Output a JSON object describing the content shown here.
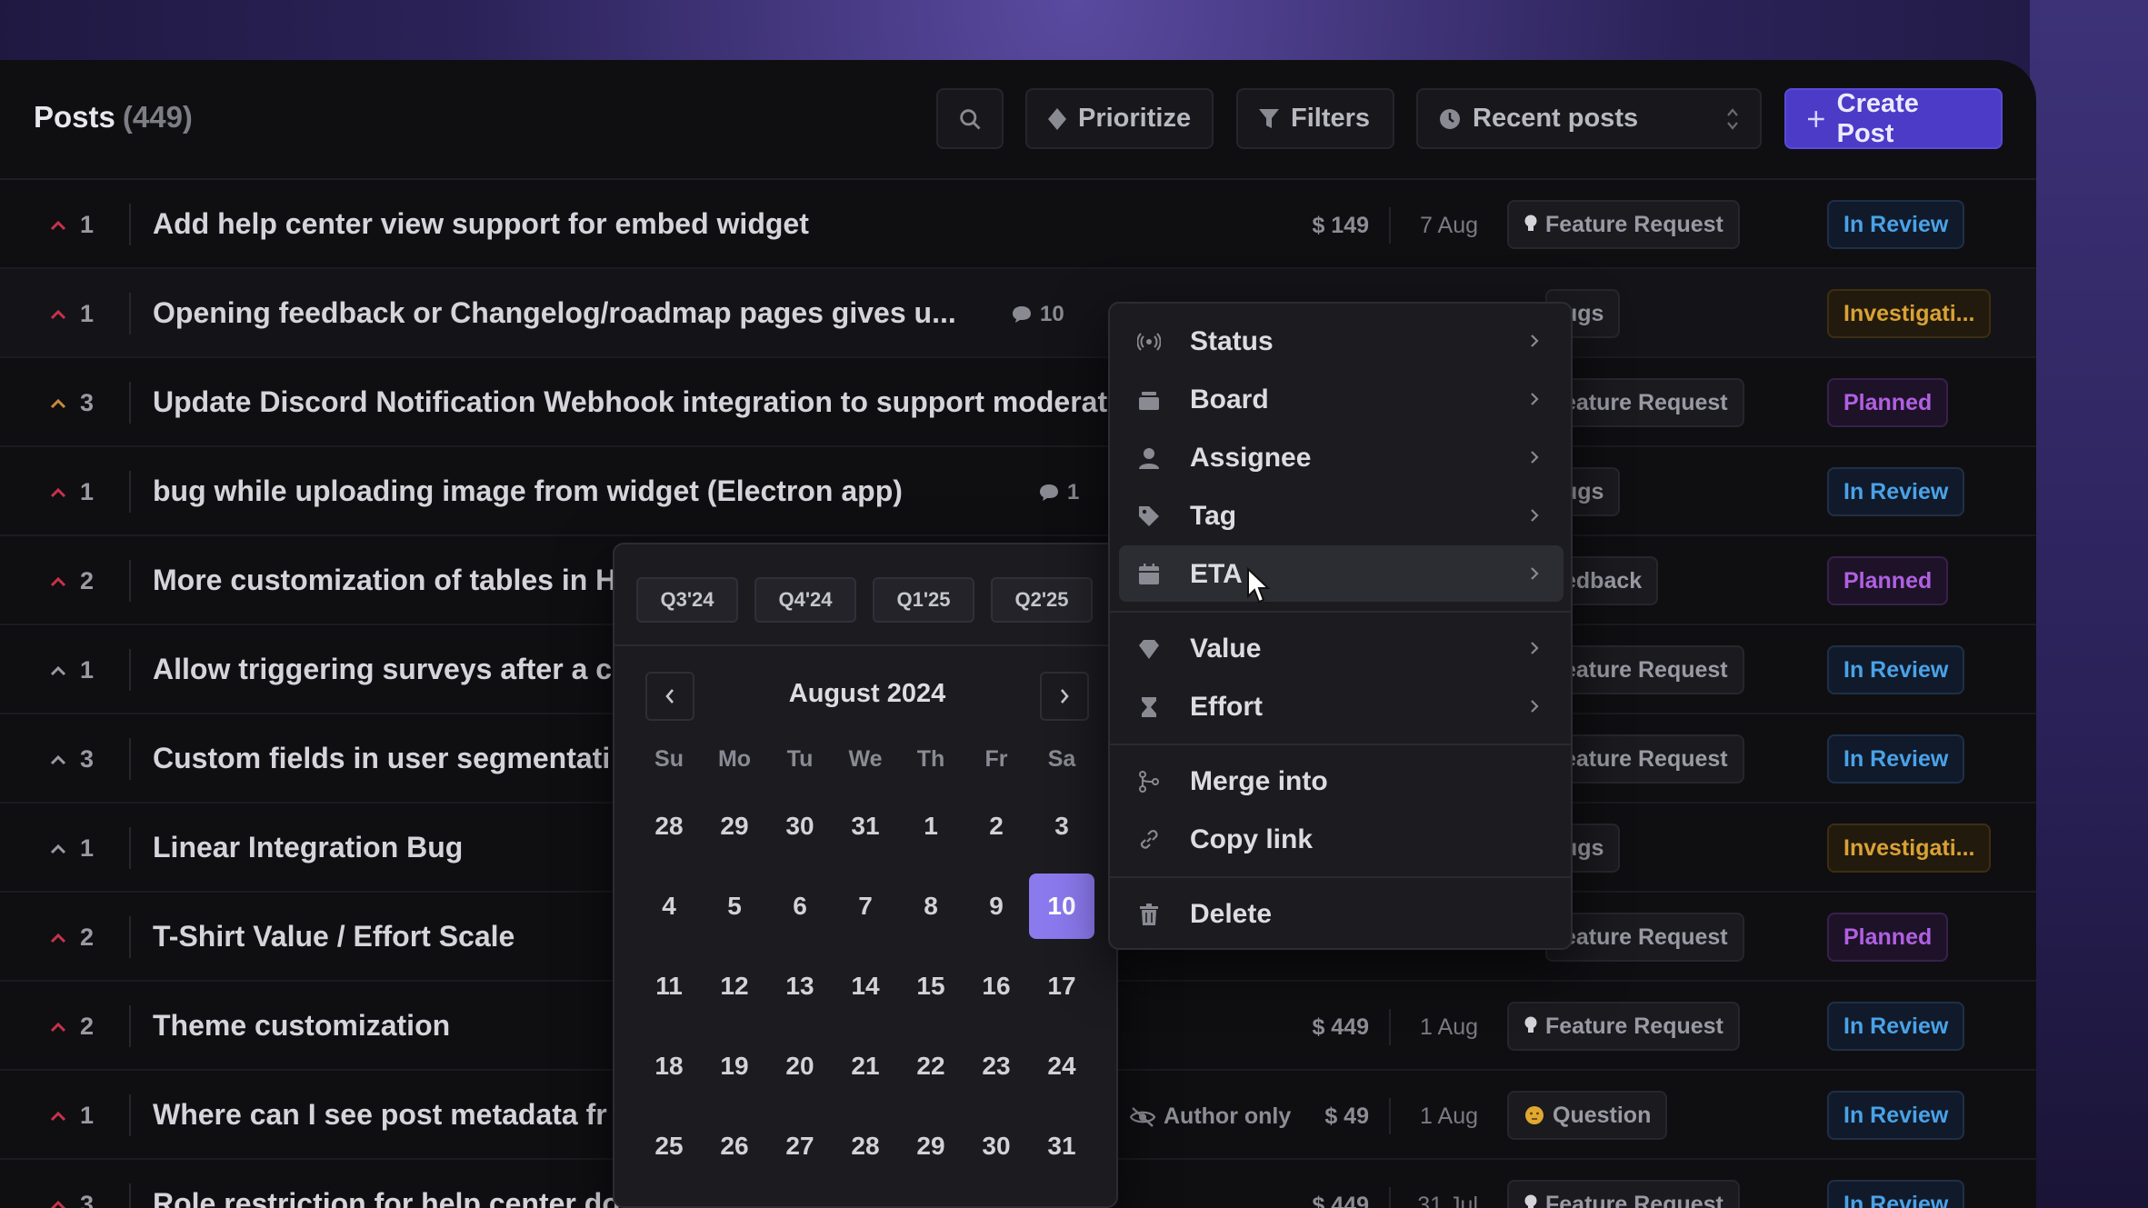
{
  "header": {
    "title": "Posts",
    "count": "(449)",
    "prioritize_label": "Prioritize",
    "filters_label": "Filters",
    "sort_label": "Recent posts",
    "create_label": "Create Post"
  },
  "rows": [
    {
      "votes": "1",
      "title": "Add help center view support for embed widget",
      "comments": "",
      "money": "$ 149",
      "date": "7 Aug",
      "tag": "Feature Request",
      "status": "In Review"
    },
    {
      "votes": "1",
      "title": "Opening feedback or Changelog/roadmap pages gives u...",
      "comments": "10",
      "money": "",
      "date": "",
      "tag": "ugs",
      "status": "Investigati..."
    },
    {
      "votes": "3",
      "title": "Update Discord Notification Webhook integration to support moderat",
      "comments": "",
      "money": "",
      "date": "",
      "tag": "eature Request",
      "status": "Planned"
    },
    {
      "votes": "1",
      "title": "bug while uploading image from widget (Electron app)",
      "comments": "1",
      "money": "",
      "date": "",
      "tag": "ugs",
      "status": "In Review"
    },
    {
      "votes": "2",
      "title": "More customization of tables in H",
      "comments": "",
      "money": "",
      "date": "",
      "tag": "edback",
      "status": "Planned"
    },
    {
      "votes": "1",
      "title": "Allow triggering surveys after a c",
      "comments": "",
      "money": "",
      "date": "",
      "tag": "eature Request",
      "status": "In Review"
    },
    {
      "votes": "3",
      "title": "Custom fields in user segmentati",
      "comments": "",
      "money": "",
      "date": "",
      "tag": "eature Request",
      "status": "In Review"
    },
    {
      "votes": "1",
      "title": "Linear Integration Bug",
      "comments": "",
      "money": "",
      "date": "",
      "tag": "ugs",
      "status": "Investigati..."
    },
    {
      "votes": "2",
      "title": "T-Shirt Value / Effort Scale",
      "comments": "",
      "money": "",
      "date": "",
      "tag": "eature Request",
      "status": "Planned"
    },
    {
      "votes": "2",
      "title": "Theme customization",
      "comments": "",
      "money": "$ 449",
      "date": "1 Aug",
      "tag": "Feature Request",
      "status": "In Review"
    },
    {
      "votes": "1",
      "title": "Where can I see post metadata fr",
      "comments": "",
      "author": "Author only",
      "money": "$ 49",
      "date": "1 Aug",
      "tag": "Question",
      "status": "In Review"
    },
    {
      "votes": "3",
      "title": "Role restriction for help center do",
      "comments": "",
      "money": "$ 449",
      "date": "31 Jul",
      "tag": "Feature Request",
      "status": "In Review"
    }
  ],
  "context_menu": {
    "items": [
      "Status",
      "Board",
      "Assignee",
      "Tag",
      "ETA",
      "Value",
      "Effort",
      "Merge into",
      "Copy link",
      "Delete"
    ],
    "active": "ETA"
  },
  "date_picker": {
    "quarters": [
      "Q3'24",
      "Q4'24",
      "Q1'25",
      "Q2'25"
    ],
    "month_label": "August 2024",
    "weekdays": [
      "Su",
      "Mo",
      "Tu",
      "We",
      "Th",
      "Fr",
      "Sa"
    ],
    "weeks": [
      [
        "28",
        "29",
        "30",
        "31",
        "1",
        "2",
        "3"
      ],
      [
        "4",
        "5",
        "6",
        "7",
        "8",
        "9",
        "10"
      ],
      [
        "11",
        "12",
        "13",
        "14",
        "15",
        "16",
        "17"
      ],
      [
        "18",
        "19",
        "20",
        "21",
        "22",
        "23",
        "24"
      ],
      [
        "25",
        "26",
        "27",
        "28",
        "29",
        "30",
        "31"
      ]
    ],
    "selected_day": "10"
  },
  "colors": {
    "accent": "#4b3bc7",
    "selected_day": "#8b79ee",
    "in_review": "#4aa2e8",
    "investigating": "#d9a236",
    "planned": "#b060e2",
    "upvote": "#c8324a"
  }
}
